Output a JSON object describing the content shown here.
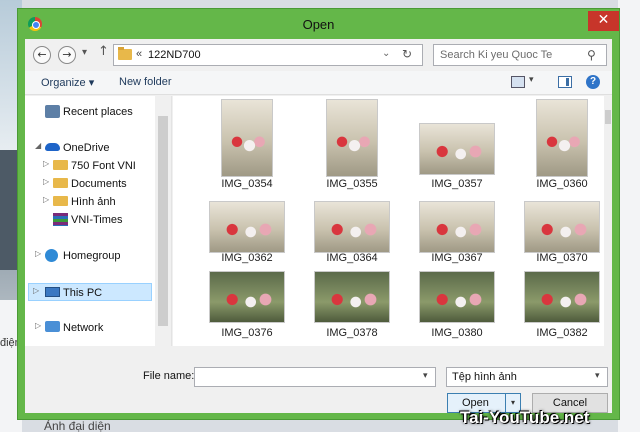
{
  "background": {
    "left_text": "điện",
    "bottom_text": "Ảnh đại diện"
  },
  "dialog": {
    "title": "Open",
    "close_glyph": "✕"
  },
  "address_bar": {
    "back_glyph": "←",
    "forward_glyph": "→",
    "recent_glyph": "▾",
    "up_glyph": "↑",
    "chevron": "«",
    "path": "122ND700",
    "dropdown_glyph": "⌄",
    "refresh_glyph": "↻"
  },
  "search": {
    "placeholder": "Search Ki yeu Quoc Te",
    "icon_glyph": "⚲"
  },
  "toolbar": {
    "organize_label": "Organize ▾",
    "new_folder_label": "New folder",
    "view_drop_glyph": "▾",
    "help_glyph": "?"
  },
  "nav": {
    "items": [
      {
        "label": "Recent places",
        "expander": "",
        "icon": "recent-places-icon"
      },
      {
        "label": "OneDrive",
        "expander": "◢",
        "icon": "onedrive-icon"
      },
      {
        "label": "750 Font VNI",
        "expander": "▷",
        "icon": "folder-icon"
      },
      {
        "label": "Documents",
        "expander": "▷",
        "icon": "folder-icon"
      },
      {
        "label": "Hình ảnh",
        "expander": "▷",
        "icon": "folder-icon"
      },
      {
        "label": "VNI-Times",
        "expander": "",
        "icon": "winrar-icon"
      },
      {
        "label": "Homegroup",
        "expander": "▷",
        "icon": "homegroup-icon"
      },
      {
        "label": "This PC",
        "expander": "▷",
        "icon": "this-pc-icon"
      },
      {
        "label": "Network",
        "expander": "▷",
        "icon": "network-icon"
      }
    ]
  },
  "files": [
    {
      "name": "IMG_0354",
      "orientation": "portrait"
    },
    {
      "name": "IMG_0355",
      "orientation": "portrait"
    },
    {
      "name": "IMG_0357",
      "orientation": "landscape"
    },
    {
      "name": "IMG_0360",
      "orientation": "portrait"
    },
    {
      "name": "IMG_0362",
      "orientation": "landscape"
    },
    {
      "name": "IMG_0364",
      "orientation": "landscape"
    },
    {
      "name": "IMG_0367",
      "orientation": "landscape"
    },
    {
      "name": "IMG_0370",
      "orientation": "landscape"
    },
    {
      "name": "IMG_0376",
      "orientation": "landscape"
    },
    {
      "name": "IMG_0378",
      "orientation": "landscape"
    },
    {
      "name": "IMG_0380",
      "orientation": "landscape"
    },
    {
      "name": "IMG_0382",
      "orientation": "landscape"
    }
  ],
  "footer": {
    "file_name_label": "File name:",
    "file_name_value": "",
    "file_type_value": "Tệp hình ảnh",
    "dropdown_glyph": "▾",
    "open_label": "Open",
    "open_split_glyph": "▾",
    "cancel_label": "Cancel"
  },
  "watermark": "Tai-YouTube.net",
  "colors": {
    "frame": "#64b749",
    "close": "#c7352a",
    "selection": "#cce8ff",
    "link": "#1e395b"
  }
}
